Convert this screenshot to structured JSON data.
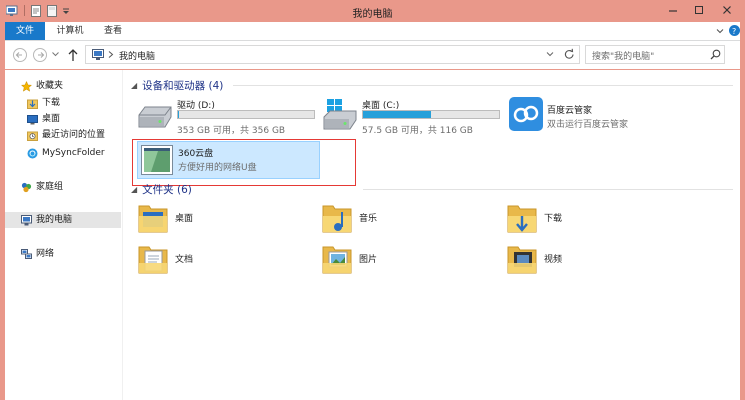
{
  "window": {
    "title": "我的电脑",
    "controls": [
      "minimize",
      "maximize",
      "close"
    ]
  },
  "ribbon": {
    "tabs": [
      {
        "label": "文件",
        "active": true
      },
      {
        "label": "计算机",
        "active": false
      },
      {
        "label": "查看",
        "active": false
      }
    ]
  },
  "navbar": {
    "breadcrumb": [
      "我的电脑"
    ],
    "search_placeholder": "搜索\"我的电脑\""
  },
  "sidebar": {
    "favorites_label": "收藏夹",
    "favorites": [
      {
        "label": "下载",
        "icon": "download-folder-icon"
      },
      {
        "label": "桌面",
        "icon": "desktop-icon"
      },
      {
        "label": "最近访问的位置",
        "icon": "recent-places-icon"
      },
      {
        "label": "MySyncFolder",
        "icon": "sync-folder-icon"
      }
    ],
    "homegroup_label": "家庭组",
    "computer_label": "我的电脑",
    "network_label": "网络"
  },
  "devices": {
    "header": "设备和驱动器 (4)",
    "drives": [
      {
        "name": "驱动 (D:)",
        "info": "353 GB 可用，共 356 GB",
        "used_fraction": 0.01,
        "icon": "hard-drive-icon"
      },
      {
        "name": "桌面 (C:)",
        "info": "57.5 GB 可用，共 116 GB",
        "used_fraction": 0.5,
        "icon": "windows-drive-icon"
      }
    ],
    "apps": [
      {
        "name": "百度云管家",
        "info": "双击运行百度云管家",
        "icon": "baidu-cloud-icon"
      },
      {
        "name": "360云盘",
        "info": "方便好用的网络U盘",
        "icon": "360-cloud-icon",
        "selected": true
      }
    ]
  },
  "folders": {
    "header": "文件夹 (6)",
    "items": [
      {
        "name": "桌面",
        "icon": "desktop-folder-icon"
      },
      {
        "name": "音乐",
        "icon": "music-folder-icon"
      },
      {
        "name": "下载",
        "icon": "downloads-folder-icon"
      },
      {
        "name": "文档",
        "icon": "documents-folder-icon"
      },
      {
        "name": "图片",
        "icon": "pictures-folder-icon"
      },
      {
        "name": "视频",
        "icon": "videos-folder-icon"
      }
    ]
  },
  "colors": {
    "title_bar": "#e9988a",
    "file_tab": "#1979ca",
    "selection_fill": "#cce8ff",
    "selection_border": "#99d1ff",
    "highlight_box": "#e53935",
    "drive_bar": "#26a0da",
    "section_header": "#1e3287"
  }
}
